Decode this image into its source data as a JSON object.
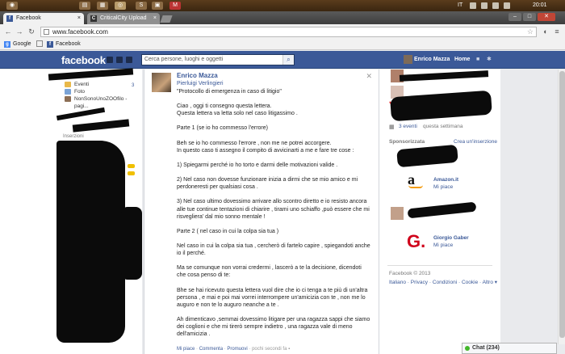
{
  "taskbar": {
    "language": "IT",
    "clock": "20:01"
  },
  "browser": {
    "tabs": [
      {
        "label": "Facebook",
        "active": true
      },
      {
        "label": "CriticalCity Upload",
        "active": false
      }
    ],
    "url": "www.facebook.com",
    "bookmarks": [
      "Google",
      "Facebook"
    ]
  },
  "facebook": {
    "logo": "facebook",
    "search_placeholder": "Cerca persone, luoghi e oggetti",
    "user_name": "Enrico Mazza",
    "home_label": "Home"
  },
  "left": {
    "items": [
      "Eventi",
      "Foto",
      "NonSonoUnoZOOfilo - pagi..."
    ],
    "count": "3",
    "section_label": "Inserzioni"
  },
  "post": {
    "author": "Enrico Mazza",
    "mention": "Pierluigi Verlingieri",
    "paragraphs": [
      "\"Protocollo di emergenza in caso di litigio\"",
      "Ciao , oggi ti consegno questa lettera.\nQuesta lettera va letta solo nel caso litigassimo .",
      "Parte 1 (se io ho commesso l'errore)",
      "Beh se io ho commesso l'errore , non me ne potrei accorgere.\nIn questo caso ti assegno il compito di avvicinarti a me e fare tre cose :",
      "1) Spiegarmi perché io ho torto e darmi delle motivazioni valide .",
      "2) Nel caso non dovesse funzionare inizia a dirmi che se mio amico e mi perdoneresti per qualsiasi cosa .",
      "3) Nel caso ultimo dovessimo arrivare allo scontro diretto e io resisto ancora alle tue continue tentazioni di chiarire , tirami uno schiaffo ,può essere che mi risvegliera' dal mio sonno mentale !",
      "Parte 2 ( nel caso in cui la colpa sia tua )",
      "Nel caso in cui la colpa sia tua , cercherò di fartelo capire , spiegandoti anche io il perché.",
      "Ma se comunque non vorrai credermi , lascerò a te la decisione, dicendoti che cosa penso di te:",
      "Bhe se hai ricevuto questa lettera vuol dire che io ci tenga a te più di un'altra persona , e mai e poi mai vorrei interrompere un'amicizia con te , non me lo auguro e non te lo auguro neanche a te .",
      "Ah dimenticavo ,semmai dovessimo litigare per una ragazza sappi che siamo dei coglioni e che mi tirerò sempre indietro , una ragazza vale di meno dell'amicizia ."
    ],
    "actions": {
      "like": "Mi piace",
      "comment": "Commenta",
      "promote": "Promuovi",
      "time": "pochi secondi fa"
    }
  },
  "right": {
    "events_count": "3 eventi",
    "events_suffix": "questa settimana",
    "sponsored_label": "Sponsorizzata",
    "create_ad": "Crea un'inserzione",
    "ads": [
      {
        "name": "Amazon.it",
        "like": "Mi piace"
      },
      {
        "name": "Giorgio Gaber",
        "like": "Mi piace"
      }
    ],
    "footer_copyright": "Facebook © 2013",
    "footer_links": "Italiano · Privacy · Condizioni · Cookie · Altro ▾"
  },
  "chat": {
    "label": "Chat (234)"
  },
  "colors": {
    "facebook_blue": "#3b5998",
    "taskbar": "#4a3218"
  }
}
